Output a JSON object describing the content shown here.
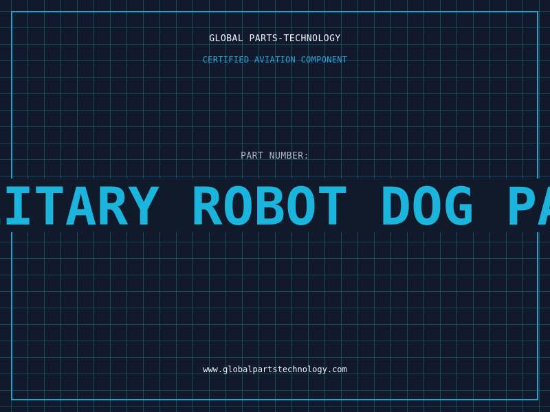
{
  "label": {
    "company": "GLOBAL PARTS-TECHNOLOGY",
    "subtitle": "CERTIFIED AVIATION COMPONENT",
    "part_number_label": "PART NUMBER:",
    "part_number_value": "MILITARY ROBOT DOG PART",
    "website": "www.globalpartstechnology.com"
  },
  "colors": {
    "background": "#111a2c",
    "grid": "#266e8c",
    "border": "#18a9cf",
    "accent": "#1ab4dc",
    "subtitle": "#29a6d6"
  }
}
